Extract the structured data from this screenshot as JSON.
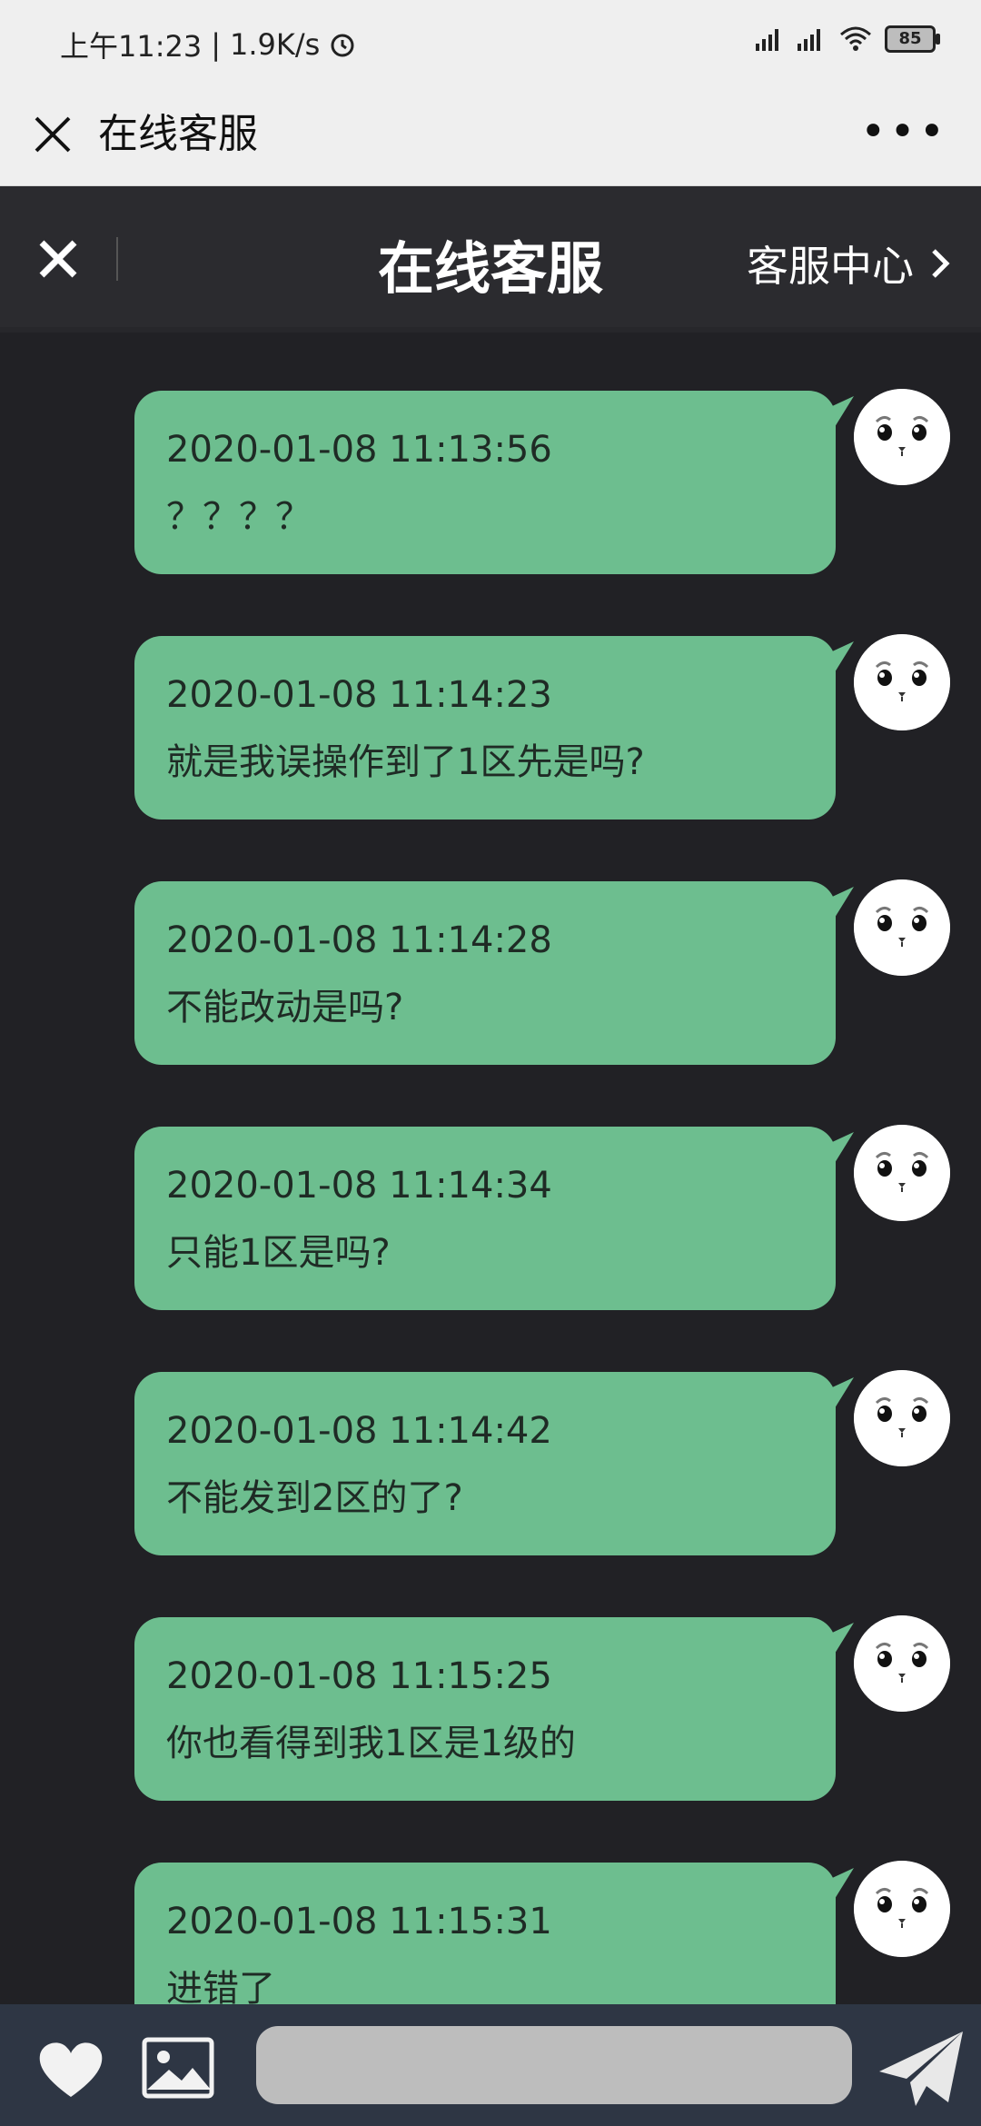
{
  "status_bar": {
    "time": "上午11:23",
    "separator": "|",
    "net_speed": "1.9K/s",
    "battery": "85"
  },
  "app_bar": {
    "title": "在线客服"
  },
  "page_header": {
    "title": "在线客服",
    "service_center": "客服中心"
  },
  "messages": [
    {
      "timestamp": "2020-01-08 11:13:56",
      "text": "？？？？"
    },
    {
      "timestamp": "2020-01-08 11:14:23",
      "text": "就是我误操作到了1区先是吗?"
    },
    {
      "timestamp": "2020-01-08 11:14:28",
      "text": "不能改动是吗?"
    },
    {
      "timestamp": "2020-01-08 11:14:34",
      "text": "只能1区是吗?"
    },
    {
      "timestamp": "2020-01-08 11:14:42",
      "text": "不能发到2区的了?"
    },
    {
      "timestamp": "2020-01-08 11:15:25",
      "text": "你也看得到我1区是1级的"
    },
    {
      "timestamp": "2020-01-08 11:15:31",
      "text": "进错了"
    }
  ],
  "input": {
    "placeholder": "",
    "value": ""
  },
  "colors": {
    "bubble": "#6dbe8f",
    "background": "#212125",
    "input_bar": "#2e3644"
  }
}
